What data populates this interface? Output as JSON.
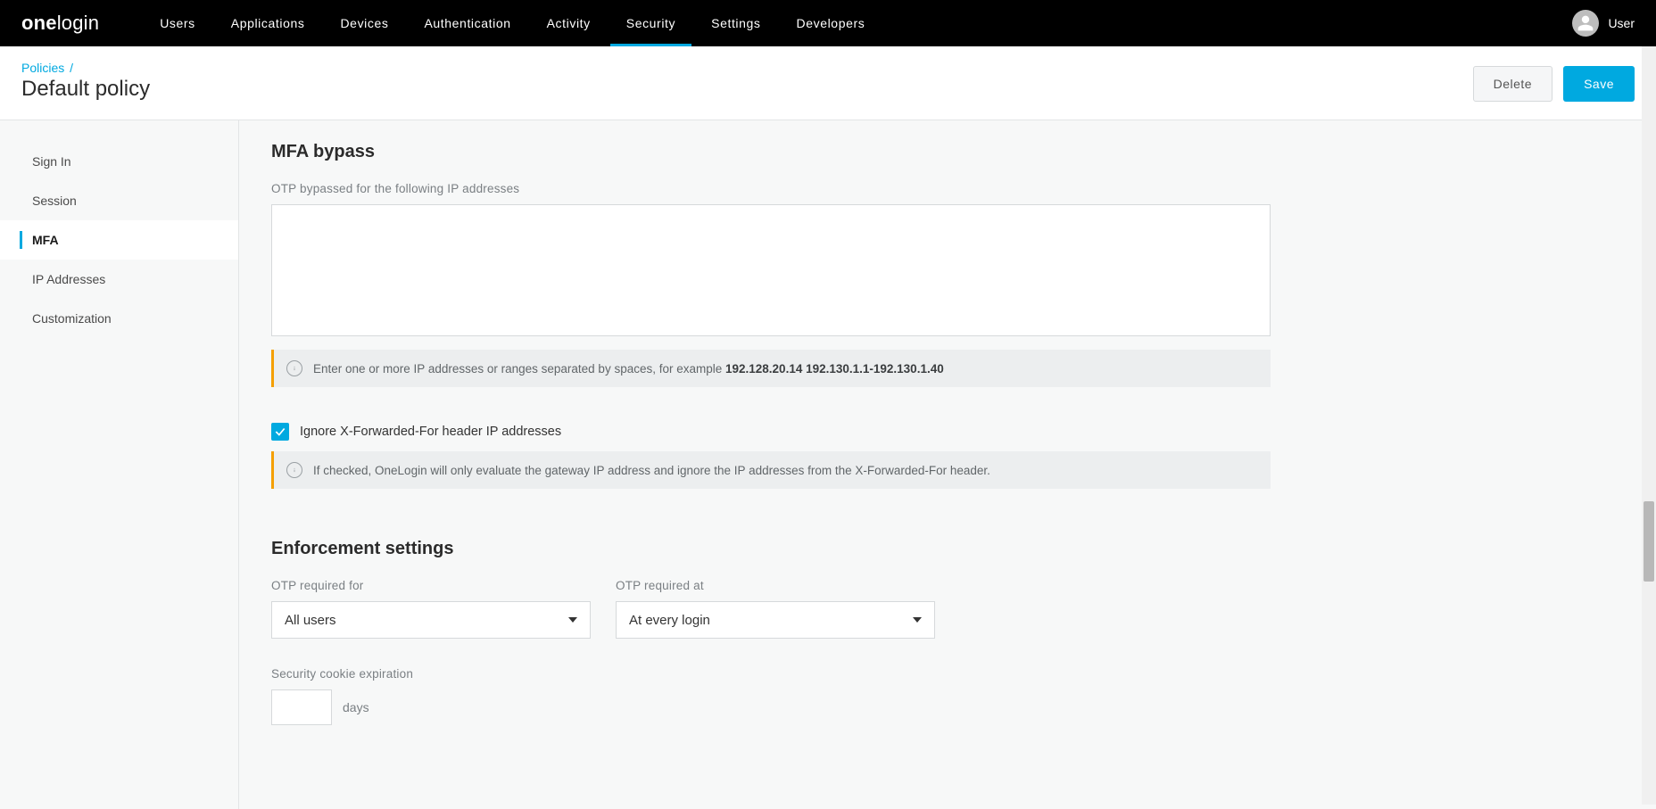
{
  "brand": {
    "part1": "one",
    "part2": "login"
  },
  "nav": {
    "items": [
      {
        "label": "Users"
      },
      {
        "label": "Applications"
      },
      {
        "label": "Devices"
      },
      {
        "label": "Authentication"
      },
      {
        "label": "Activity"
      },
      {
        "label": "Security",
        "active": true
      },
      {
        "label": "Settings"
      },
      {
        "label": "Developers"
      }
    ],
    "user_label": "User"
  },
  "header": {
    "breadcrumb_root": "Policies",
    "breadcrumb_sep": "/",
    "title": "Default policy",
    "delete_label": "Delete",
    "save_label": "Save"
  },
  "sidebar": {
    "items": [
      {
        "label": "Sign In"
      },
      {
        "label": "Session"
      },
      {
        "label": "MFA",
        "active": true
      },
      {
        "label": "IP Addresses"
      },
      {
        "label": "Customization"
      }
    ]
  },
  "mfa_bypass": {
    "title": "MFA bypass",
    "ip_label": "OTP bypassed for the following IP addresses",
    "ip_value": "",
    "info_prefix": "Enter one or more IP addresses or ranges separated by spaces, for example ",
    "info_bold": "192.128.20.14 192.130.1.1-192.130.1.40",
    "xff_checked": true,
    "xff_label": "Ignore X-Forwarded-For header IP addresses",
    "xff_info": "If checked, OneLogin will only evaluate the gateway IP address and ignore the IP addresses from the X-Forwarded-For header."
  },
  "enforcement": {
    "title": "Enforcement settings",
    "otp_for_label": "OTP required for",
    "otp_for_value": "All users",
    "otp_at_label": "OTP required at",
    "otp_at_value": "At every login",
    "cookie_label": "Security cookie expiration",
    "cookie_value": "",
    "cookie_unit": "days"
  }
}
